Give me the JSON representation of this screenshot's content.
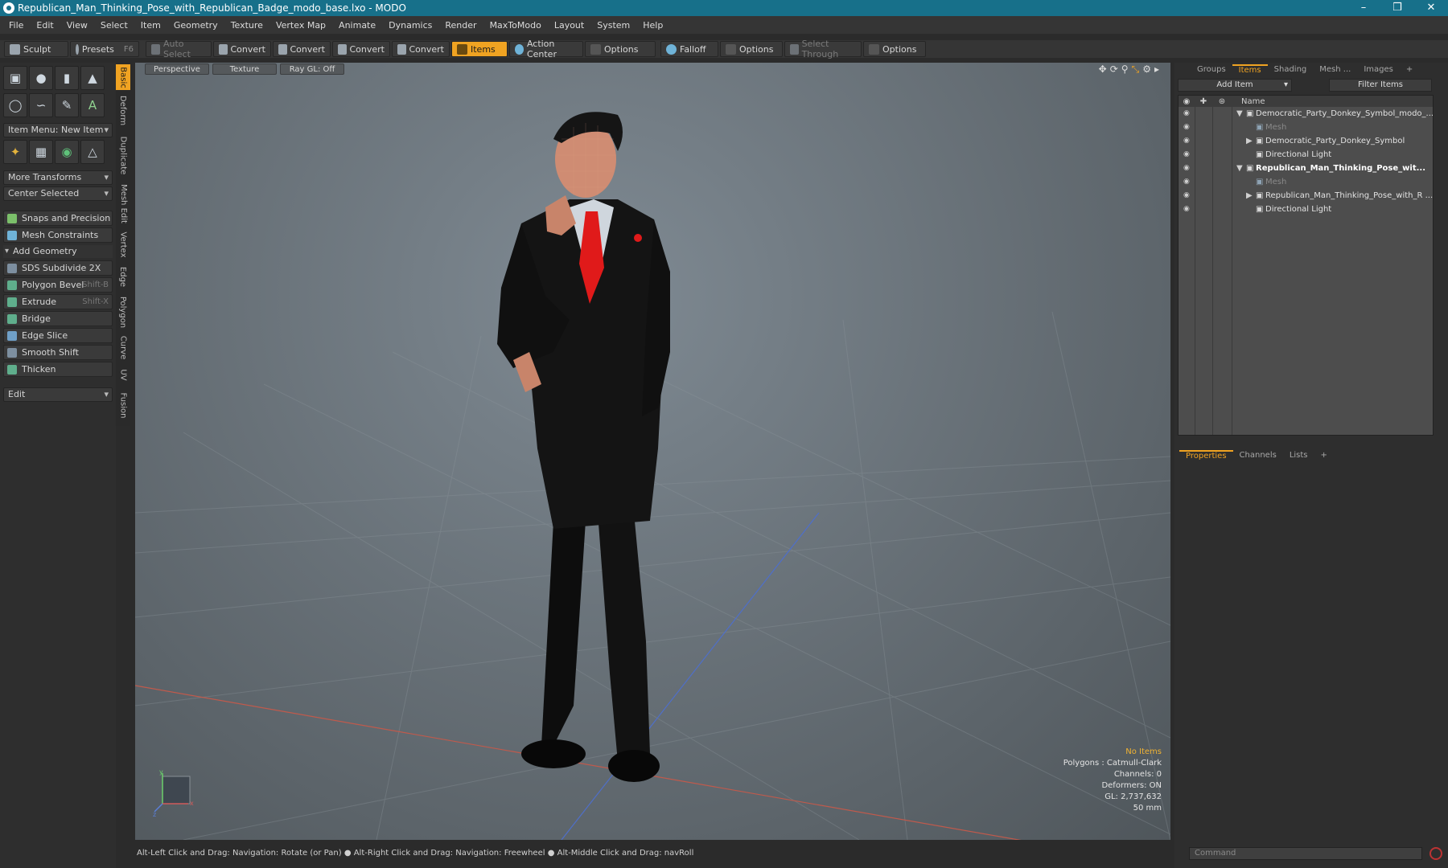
{
  "window": {
    "title": "Republican_Man_Thinking_Pose_with_Republican_Badge_modo_base.lxo - MODO",
    "minimize": "–",
    "maximize": "❒",
    "close": "✕"
  },
  "menu": [
    "File",
    "Edit",
    "View",
    "Select",
    "Item",
    "Geometry",
    "Texture",
    "Vertex Map",
    "Animate",
    "Dynamics",
    "Render",
    "MaxToModo",
    "Layout",
    "System",
    "Help"
  ],
  "toolbar": {
    "sculpt": "Sculpt",
    "presets": "Presets",
    "presets_shortcut": "F6",
    "auto_select": "Auto Select",
    "convert1": "Convert",
    "convert2": "Convert",
    "convert3": "Convert",
    "convert4": "Convert",
    "items": "Items",
    "action_center": "Action Center",
    "options1": "Options",
    "falloff": "Falloff",
    "options2": "Options",
    "select_through": "Select Through",
    "options3": "Options"
  },
  "left": {
    "item_menu": "Item Menu: New Item",
    "more_transforms": "More Transforms",
    "center_selected": "Center Selected",
    "snaps": "Snaps and Precision",
    "mesh_constraints": "Mesh Constraints",
    "add_geometry": "Add Geometry",
    "tools": [
      {
        "label": "SDS Subdivide 2X",
        "shortcut": ""
      },
      {
        "label": "Polygon Bevel",
        "shortcut": "Shift-B"
      },
      {
        "label": "Extrude",
        "shortcut": "Shift-X"
      },
      {
        "label": "Bridge",
        "shortcut": ""
      },
      {
        "label": "Edge Slice",
        "shortcut": ""
      },
      {
        "label": "Smooth Shift",
        "shortcut": ""
      },
      {
        "label": "Thicken",
        "shortcut": ""
      }
    ],
    "edit": "Edit"
  },
  "vtabs": [
    "Basic",
    "Deform",
    "Duplicate",
    "Mesh Edit",
    "Vertex",
    "Edge",
    "Polygon",
    "Curve",
    "UV",
    "Fusion"
  ],
  "viewport": {
    "perspective": "Perspective",
    "texture": "Texture",
    "raygl": "Ray GL: Off",
    "stats": {
      "no_items": "No Items",
      "polygons": "Polygons : Catmull-Clark",
      "channels": "Channels: 0",
      "deformers": "Deformers: ON",
      "gl": "GL: 2,737,632",
      "focal": "50 mm"
    },
    "axis_y": "y",
    "axis_x": "x",
    "axis_z": "z"
  },
  "status": "Alt-Left Click and Drag: Navigation: Rotate (or Pan) ●  Alt-Right Click and Drag: Navigation: Freewheel ●  Alt-Middle Click and Drag: navRoll",
  "right": {
    "tabs": [
      "Groups",
      "Items",
      "Shading",
      "Mesh ...",
      "Images"
    ],
    "add_item": "Add Item",
    "filter_items": "Filter Items",
    "col_name": "Name",
    "tree": [
      {
        "label": "Democratic_Party_Donkey_Symbol_modo_...",
        "indent": 0,
        "style": "",
        "arrow": "▼"
      },
      {
        "label": "Mesh",
        "indent": 1,
        "style": "dim",
        "arrow": ""
      },
      {
        "label": "Democratic_Party_Donkey_Symbol",
        "indent": 1,
        "style": "",
        "arrow": "▶"
      },
      {
        "label": "Directional Light",
        "indent": 1,
        "style": "",
        "arrow": ""
      },
      {
        "label": "Republican_Man_Thinking_Pose_wit...",
        "indent": 0,
        "style": "bold",
        "arrow": "▼"
      },
      {
        "label": "Mesh",
        "indent": 1,
        "style": "dim",
        "arrow": ""
      },
      {
        "label": "Republican_Man_Thinking_Pose_with_R ...",
        "indent": 1,
        "style": "",
        "arrow": "▶"
      },
      {
        "label": "Directional Light",
        "indent": 1,
        "style": "",
        "arrow": ""
      }
    ],
    "prop_tabs": [
      "Properties",
      "Channels",
      "Lists"
    ],
    "command": "Command"
  }
}
